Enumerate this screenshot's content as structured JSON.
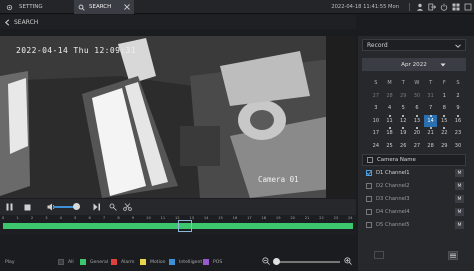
{
  "tabs": [
    {
      "label": "SETTING"
    },
    {
      "label": "SEARCH"
    }
  ],
  "topbar": {
    "datetime": "2022-04-18 11:41:55 Mon"
  },
  "title": "SEARCH",
  "video": {
    "osd_time": "2022-04-14 Thu 12:09:31",
    "osd_camera": "Camera 01"
  },
  "volume": {
    "level": 0.75
  },
  "timeline": {
    "hours": [
      "0",
      "1",
      "2",
      "3",
      "4",
      "5",
      "6",
      "7",
      "8",
      "9",
      "10",
      "11",
      "12",
      "13",
      "14",
      "15",
      "16",
      "17",
      "18",
      "19",
      "20",
      "21",
      "22",
      "23",
      "24"
    ],
    "recorded_range_hours": [
      0,
      24
    ]
  },
  "legend": {
    "play_label": "Play",
    "items": [
      {
        "label": "All",
        "color": "#3a3c40"
      },
      {
        "label": "General",
        "color": "#3cc76e"
      },
      {
        "label": "Alarm",
        "color": "#e04040"
      },
      {
        "label": "Motion",
        "color": "#e8d44a"
      },
      {
        "label": "Intelligent",
        "color": "#3d8fd6"
      },
      {
        "label": "POS",
        "color": "#9b59d0"
      }
    ]
  },
  "zoom": {
    "level": 0.0
  },
  "record_select": {
    "value": "Record"
  },
  "calendar": {
    "month_label": "Apr 2022",
    "weekdays": [
      "S",
      "M",
      "T",
      "W",
      "T",
      "F",
      "S"
    ],
    "weeks": [
      [
        "27",
        "28",
        "29",
        "30",
        "31",
        "1",
        "2"
      ],
      [
        "3",
        "4",
        "5",
        "6",
        "7",
        "8",
        "9"
      ],
      [
        "10",
        "11",
        "12",
        "13",
        "14",
        "15",
        "16"
      ],
      [
        "17",
        "18",
        "19",
        "20",
        "21",
        "22",
        "23"
      ],
      [
        "24",
        "25",
        "26",
        "27",
        "28",
        "29",
        "30"
      ],
      [
        "1",
        "2",
        "3",
        "4",
        "5",
        "6",
        "7"
      ]
    ],
    "selected_day": "14",
    "recorded_days": [
      "11",
      "12",
      "13",
      "14",
      "15",
      "16",
      "18",
      "19",
      "20",
      "21",
      "22"
    ]
  },
  "cameras": {
    "header": "Camera Name",
    "items": [
      {
        "label": "D1 Channel1",
        "checked": true,
        "button": "M"
      },
      {
        "label": "D2 Channel2",
        "checked": false,
        "button": "M"
      },
      {
        "label": "D3 Channel3",
        "checked": false,
        "button": "M"
      },
      {
        "label": "D4 Channel4",
        "checked": false,
        "button": "M"
      },
      {
        "label": "D5 Channel5",
        "checked": false,
        "button": "M"
      }
    ]
  },
  "colors": {
    "accent": "#2a6fb0",
    "record_general": "#3cc76e"
  }
}
